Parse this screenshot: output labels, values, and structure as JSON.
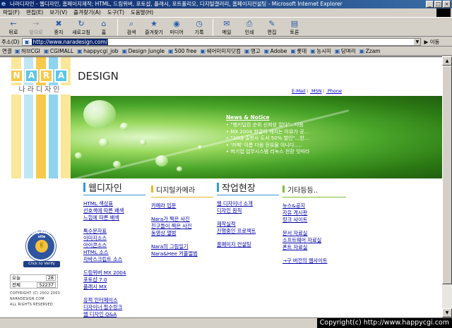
{
  "window": {
    "title": "나라디자인 - 웹디자인, 홈페이지제작; HTML, 드림위버, 포토샵, 플래시, 포트폴리오, 디지털갤러리, 홈페이지컨설팅 - Microsoft Internet Explorer",
    "buttons": [
      "_",
      "□",
      "×"
    ]
  },
  "menu": [
    "파일(F)",
    "편집(E)",
    "보기(V)",
    "즐겨찾기(A)",
    "도구(T)",
    "도움말(H)"
  ],
  "toolbar": [
    {
      "label": "뒤로",
      "icon": "back-arrow-icon",
      "glyph": "←",
      "enabled": true
    },
    {
      "label": "앞으로",
      "icon": "forward-arrow-icon",
      "glyph": "→",
      "enabled": false
    },
    {
      "label": "중지",
      "icon": "stop-icon",
      "glyph": "✖",
      "enabled": true
    },
    {
      "label": "새로고침",
      "icon": "refresh-icon",
      "glyph": "↻",
      "enabled": true
    },
    {
      "label": "홈",
      "icon": "home-icon",
      "glyph": "⌂",
      "enabled": true
    },
    {
      "label": "검색",
      "icon": "search-icon",
      "glyph": "⌕",
      "enabled": true
    },
    {
      "label": "즐겨찾기",
      "icon": "favorites-icon",
      "glyph": "★",
      "enabled": true
    },
    {
      "label": "미디어",
      "icon": "media-icon",
      "glyph": "◉",
      "enabled": true
    },
    {
      "label": "기록",
      "icon": "history-icon",
      "glyph": "◷",
      "enabled": true
    },
    {
      "label": "메일",
      "icon": "mail-icon",
      "glyph": "✉",
      "enabled": true
    },
    {
      "label": "인쇄",
      "icon": "print-icon",
      "glyph": "⎙",
      "enabled": true
    },
    {
      "label": "편집",
      "icon": "edit-icon",
      "glyph": "✎",
      "enabled": true
    },
    {
      "label": "토론",
      "icon": "discuss-icon",
      "glyph": "▤",
      "enabled": true
    }
  ],
  "address": {
    "label": "주소(D)",
    "url": "http://www.naradesign.com/",
    "go_label": "이동"
  },
  "links": {
    "label": "연결",
    "items": [
      "허브CGI",
      "CGIMALL",
      "happycgi_job",
      "Design Jungle",
      "500 free",
      "쉐어미미지닷컴",
      "맹고",
      "Adobe",
      "롯데",
      "농시미",
      "당며리",
      "Zzam"
    ]
  },
  "page": {
    "logo_letters": [
      "N",
      "A",
      "R",
      "A"
    ],
    "logo_colors": [
      "#f6c94a",
      "#5cc6e8",
      "#f6c94a",
      "#5cc6e8"
    ],
    "stripe_colors": [
      "#fbe79a",
      "#bfe6f4",
      "#f6c94a",
      "#8fd4ee",
      "#fbe79a"
    ],
    "logo_sub": "나라디자인",
    "design_title": "DESIGN",
    "top_links": [
      "E-Mail",
      "MSN",
      "Phone"
    ],
    "news": {
      "title": "News & Notice",
      "items": [
        "\"행키덥컴 순위 신뢰성 있다\"...다음",
        "MX 2004 한글이 깨지는 이유가 공...",
        "\"10대 출판사 도서 50% 할인\"...한...",
        "'카페' 이름 다음 전유물 아니다.....",
        "머기업 업무시스템 리눅스 전환 잇따라"
      ]
    },
    "badge": {
      "ring_text": "Reality Favorite site",
      "verify": "Click to Verify"
    },
    "counter": {
      "today_label": "오늘",
      "today_value": "28",
      "total_label": "전체",
      "total_value": "52237"
    },
    "copyright_small": [
      "COPYRIGHT (C) 2002-2003",
      "NARADESIGN.COM",
      "ALL RIGHTS RESERVED"
    ],
    "sections": [
      {
        "title": "웹디자인",
        "color": "#2f9ad8",
        "groups": [
          [
            "HTML 색상표",
            "선호색에 따른 배색",
            "느낌에 따른 배색"
          ],
          [
            "특수문자표",
            "이미지소스",
            "아이콘소스",
            "HTML 소스",
            "자바스크립트 소스"
          ],
          [
            "드림위버 MX 2004",
            "포토샵 7.0",
            "플래시 MX"
          ],
          [
            "유적 인터페이스",
            "디자이너 필수링크",
            "웹 디자인 Q&A"
          ]
        ]
      },
      {
        "title": "디지털카메라",
        "color": "#f0b820",
        "groups": [
          [
            "카메라 입문"
          ],
          [
            "Nara가 찍은 사진",
            "친구들이 찍은 사진",
            "동영상 앨범"
          ],
          [
            "Nara의 그림일기",
            "Nara&Hee 커플앨범"
          ]
        ]
      },
      {
        "title": "작업현장",
        "color": "#2f9ad8",
        "groups": [
          [
            "웹 디자이너 소개",
            "디자인 원칙"
          ],
          [
            "제작실적",
            "진행중인 프로젝트"
          ],
          [
            "홈페이지 컨설팅"
          ]
        ]
      },
      {
        "title": "기타등등..",
        "color": "#7fbf3a",
        "groups": [
          [
            "뉴스&공지",
            "자유 게시판",
            "링크 사이트"
          ],
          [
            "문서 자료실",
            "소프트웨어 자료실",
            "폰트 자료실"
          ],
          [
            "→구 버전의 웹사이트"
          ]
        ]
      }
    ]
  },
  "watermark": "Copyright(c) http://www.happycgi.com"
}
